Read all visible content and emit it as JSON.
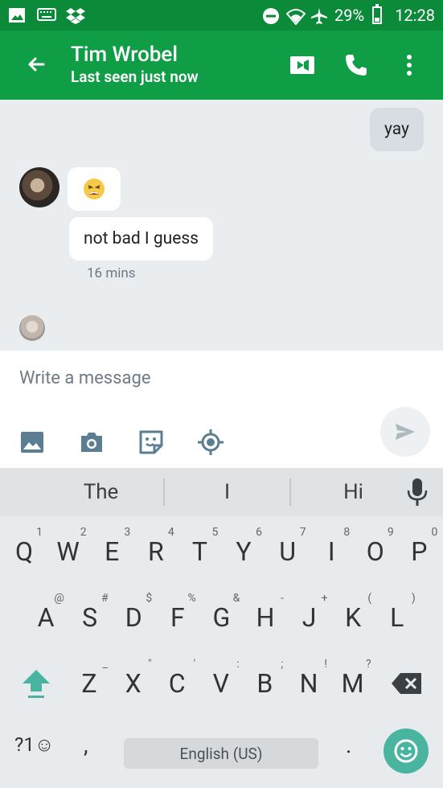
{
  "status_bar": {
    "battery_percent": "29%",
    "time": "12:28",
    "icons": [
      "image-icon",
      "keyboard-icon",
      "dropbox-icon",
      "do-not-disturb-icon",
      "wifi-icon",
      "airplane-icon",
      "battery-icon"
    ]
  },
  "header": {
    "contact_name": "Tim Wrobel",
    "last_seen": "Last seen just now",
    "icons": [
      "back-arrow-icon",
      "video-call-icon",
      "phone-call-icon",
      "more-vert-icon"
    ]
  },
  "messages": [
    {
      "direction": "outgoing",
      "text": "yay"
    },
    {
      "direction": "incoming",
      "text": "😫"
    },
    {
      "direction": "incoming",
      "text": "not bad I guess"
    }
  ],
  "timestamp": "16 mins",
  "composer": {
    "placeholder": "Write a message",
    "tool_icons": [
      "image-icon",
      "camera-icon",
      "sticker-icon",
      "location-icon",
      "send-icon"
    ]
  },
  "keyboard": {
    "suggestions": [
      "The",
      "I",
      "Hi"
    ],
    "row1": [
      {
        "k": "Q",
        "s": "1"
      },
      {
        "k": "W",
        "s": "2"
      },
      {
        "k": "E",
        "s": "3"
      },
      {
        "k": "R",
        "s": "4"
      },
      {
        "k": "T",
        "s": "5"
      },
      {
        "k": "Y",
        "s": "6"
      },
      {
        "k": "U",
        "s": "7"
      },
      {
        "k": "I",
        "s": "8"
      },
      {
        "k": "O",
        "s": "9"
      },
      {
        "k": "P",
        "s": "0"
      }
    ],
    "row2": [
      {
        "k": "A",
        "s": "@"
      },
      {
        "k": "S",
        "s": "#"
      },
      {
        "k": "D",
        "s": "$"
      },
      {
        "k": "F",
        "s": "%"
      },
      {
        "k": "G",
        "s": "&"
      },
      {
        "k": "H",
        "s": "-"
      },
      {
        "k": "J",
        "s": "+"
      },
      {
        "k": "K",
        "s": "("
      },
      {
        "k": "L",
        "s": ")"
      }
    ],
    "row3": [
      {
        "k": "Z",
        "s": "_"
      },
      {
        "k": "X",
        "s": "\""
      },
      {
        "k": "C",
        "s": "'"
      },
      {
        "k": "V",
        "s": ":"
      },
      {
        "k": "B",
        "s": ";"
      },
      {
        "k": "N",
        "s": "!"
      },
      {
        "k": "M",
        "s": "?"
      }
    ],
    "symbols_label": "?1☺",
    "comma": ",",
    "space_label": "English (US)",
    "period": "."
  },
  "colors": {
    "status_bar": "#0b8a3a",
    "app_bar": "#0f9d46",
    "emoji_key": "#49b4a0",
    "outgoing_bubble": "#d7dde2"
  }
}
